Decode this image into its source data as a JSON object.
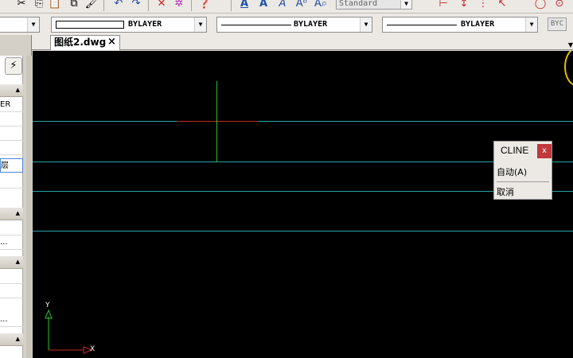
{
  "toolbar": {
    "text_style": "Standard",
    "icons": [
      "cut-icon",
      "copy-icon",
      "paste-icon",
      "paste-special-icon",
      "match-properties-icon",
      "undo-icon",
      "redo-icon",
      "erase-icon",
      "purge-icon",
      "help-icon",
      "multiline-text-icon",
      "single-line-text-icon",
      "text-style-icon",
      "spell-check-icon",
      "find-text-icon",
      "dimension-icon",
      "linear-dimension-icon",
      "aligned-dimension-icon",
      "arc-dimension-icon",
      "circle-icon"
    ]
  },
  "properties_bar": {
    "color": "BYLAYER",
    "linetype": "BYLAYER",
    "lineweight": "BYLAYER",
    "plot_style": "BYC"
  },
  "tabs": {
    "active": "图纸2.dwg",
    "close": "×"
  },
  "left_panel": {
    "rows": [
      "ER",
      "",
      "",
      "",
      "层",
      "",
      "",
      "...",
      "",
      "",
      "..."
    ]
  },
  "canvas": {
    "ucs_y": "Y",
    "ucs_x": "X"
  },
  "context_menu": {
    "title": "CLINE",
    "close": "x",
    "items": [
      "自动(A)",
      "取消"
    ]
  },
  "colors": {
    "canvas_bg": "#000000",
    "construction_line": "#2aa6a6",
    "crosshair_x": "#c62828",
    "crosshair_y": "#27c427",
    "accent_close": "#c0393b"
  }
}
